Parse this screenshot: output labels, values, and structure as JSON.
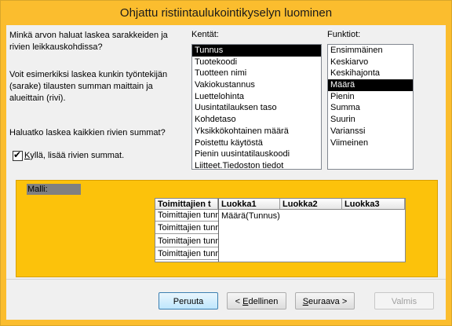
{
  "window": {
    "title": "Ohjattu ristiintaulukointikyselyn luominen"
  },
  "instructions": {
    "question": "Minkä arvon haluat laskea sarakkeiden ja rivien leikkauskohdissa?",
    "example": "Voit esimerkiksi laskea kunkin työntekijän (sarake) tilausten summan maittain ja alueittain (rivi).",
    "row_sums_question": "Haluatko laskea kaikkien rivien summat?"
  },
  "fields": {
    "label": "Kentät:",
    "items": [
      "Tunnus",
      "Tuotekoodi",
      "Tuotteen nimi",
      "Vakiokustannus",
      "Luettelohinta",
      "Uusintatilauksen taso",
      "Kohdetaso",
      "Yksikkökohtainen määrä",
      "Poistettu käytöstä",
      "Pienin uusintatilauskoodi",
      "Liitteet.Tiedoston tiedot"
    ],
    "selected": "Tunnus"
  },
  "functions": {
    "label": "Funktiot:",
    "items": [
      "Ensimmäinen",
      "Keskiarvo",
      "Keskihajonta",
      "Määrä",
      "Pienin",
      "Summa",
      "Suurin",
      "Varianssi",
      "Viimeinen"
    ],
    "selected": "Määrä"
  },
  "row_sums_checkbox": {
    "checked": true,
    "label_first": "K",
    "label_rest": "yllä, lisää rivien summat."
  },
  "sample": {
    "label": "Malli:",
    "row_header": "Toimittajien t",
    "column_headers": [
      "Luokka1",
      "Luokka2",
      "Luokka3"
    ],
    "row_values": [
      "Toimittajien tunn",
      "Toimittajien tunn",
      "Toimittajien tunn",
      "Toimittajien tunn"
    ],
    "cell_value": "Määrä(Tunnus)"
  },
  "buttons": {
    "cancel": "Peruuta",
    "back": "< Edellinen",
    "next": "Seuraava >",
    "finish": "Valmis"
  }
}
